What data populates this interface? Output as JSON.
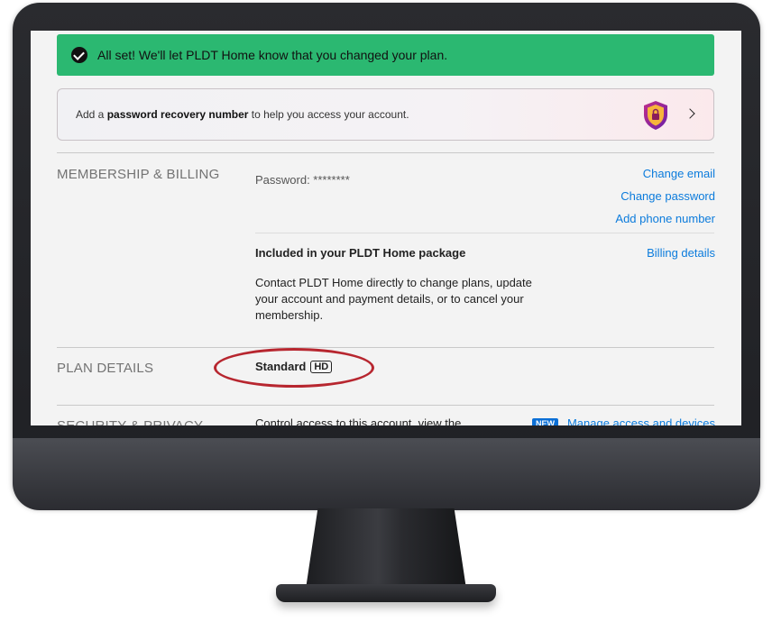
{
  "banner": {
    "message": "All set! We'll let PLDT Home know that you changed your plan."
  },
  "recovery": {
    "prefix": "Add a ",
    "bold": "password recovery number",
    "suffix": " to help you access your account."
  },
  "membership": {
    "section_title": "MEMBERSHIP & BILLING",
    "password_label": "Password: ********",
    "links": {
      "change_email": "Change email",
      "change_password": "Change password",
      "add_phone": "Add phone number",
      "billing_details": "Billing details"
    },
    "package_title": "Included in your PLDT Home package",
    "package_description": "Contact PLDT Home directly to change plans, update your account and payment details, or to cancel your membership."
  },
  "plan": {
    "section_title": "PLAN DETAILS",
    "plan_name": "Standard",
    "quality_badge": "HD"
  },
  "security": {
    "section_title": "SECURITY & PRIVACY",
    "description": "Control access to this account, view the",
    "new_badge": "NEW",
    "manage_link": "Manage access and devices"
  },
  "colors": {
    "success_green": "#2bb871",
    "link_blue": "#0b7bdc",
    "highlight_red": "#b7262f"
  }
}
